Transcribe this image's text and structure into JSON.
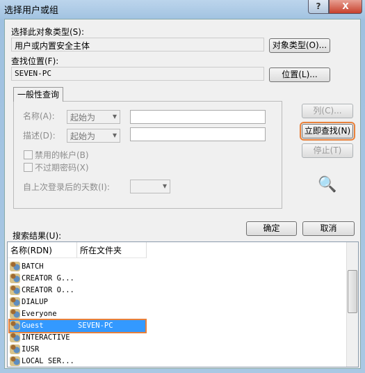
{
  "window": {
    "title": "选择用户或组",
    "help": "?",
    "close": "X"
  },
  "object_type": {
    "label": "选择此对象类型(S):",
    "value": "用户或内置安全主体",
    "button": "对象类型(O)..."
  },
  "location": {
    "label": "查找位置(F):",
    "value": "SEVEN-PC",
    "button": "位置(L)..."
  },
  "query": {
    "tab": "一般性查询",
    "name_label": "名称(A):",
    "name_mode": "起始为",
    "desc_label": "描述(D):",
    "desc_mode": "起始为",
    "disabled_accounts": "禁用的帐户(B)",
    "no_expire_pwd": "不过期密码(X)",
    "days_label": "自上次登录后的天数(I):",
    "columns": "列(C)...",
    "find_now": "立即查找(N)",
    "stop": "停止(T)"
  },
  "ok": "确定",
  "cancel": "取消",
  "results": {
    "label": "搜索结果(U):",
    "columns": [
      "名称(RDN)",
      "所在文件夹"
    ],
    "rows": [
      {
        "name": "BATCH",
        "folder": ""
      },
      {
        "name": "CREATOR G...",
        "folder": ""
      },
      {
        "name": "CREATOR O...",
        "folder": ""
      },
      {
        "name": "DIALUP",
        "folder": ""
      },
      {
        "name": "Everyone",
        "folder": ""
      },
      {
        "name": "Guest",
        "folder": "SEVEN-PC",
        "selected": true
      },
      {
        "name": "INTERACTIVE",
        "folder": ""
      },
      {
        "name": "IUSR",
        "folder": ""
      },
      {
        "name": "LOCAL SER...",
        "folder": ""
      }
    ]
  }
}
